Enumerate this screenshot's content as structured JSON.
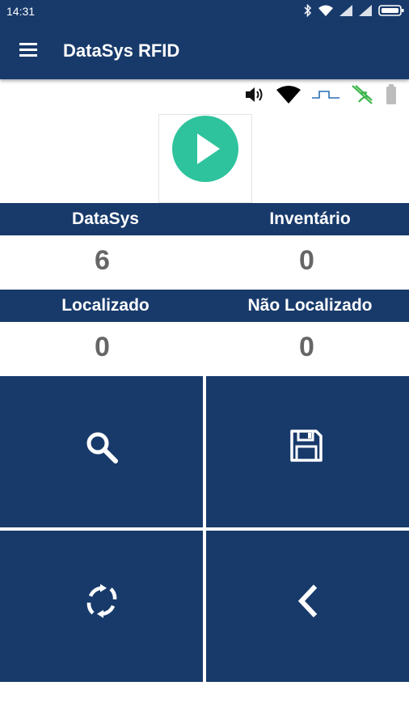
{
  "status_bar": {
    "time": "14:31",
    "icons": [
      "bluetooth-icon",
      "wifi-icon",
      "signal-icon",
      "signal-icon",
      "battery-icon"
    ]
  },
  "app_bar": {
    "title": "DataSys RFID",
    "menu_icon": "menu-icon"
  },
  "device_status": {
    "icons": [
      "volume-icon",
      "wifi-icon",
      "pulse-icon",
      "rfid-signal-icon",
      "battery-icon"
    ],
    "rfid_color": "#3cb54a",
    "pulse_color": "#2a6fb3",
    "battery_color": "#bdbdbd"
  },
  "play_button": {
    "icon": "play-icon",
    "color": "#2ec39d"
  },
  "stats": {
    "row1": {
      "left_label": "DataSys",
      "right_label": "Inventário",
      "left_value": "6",
      "right_value": "0"
    },
    "row2": {
      "left_label": "Localizado",
      "right_label": "Não Localizado",
      "left_value": "0",
      "right_value": "0"
    }
  },
  "actions": [
    {
      "icon": "search-icon"
    },
    {
      "icon": "save-icon"
    },
    {
      "icon": "refresh-icon"
    },
    {
      "icon": "back-icon"
    }
  ],
  "colors": {
    "primary": "#183a6b",
    "accent": "#2ec39d",
    "value_text": "#666666"
  }
}
